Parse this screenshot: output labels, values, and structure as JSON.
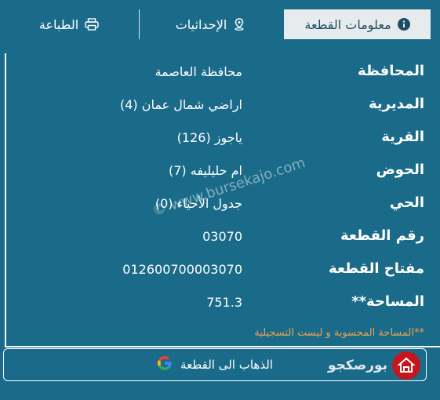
{
  "tabs": {
    "info": {
      "label": "معلومات القطعة",
      "icon": "info-icon"
    },
    "coords": {
      "label": "الإحداثيات",
      "icon": "location-pin-icon"
    },
    "print": {
      "label": "الطباعة",
      "icon": "printer-icon"
    }
  },
  "rows": [
    {
      "label": "المحافظة",
      "value": "محافظة العاصمة"
    },
    {
      "label": "المديرية",
      "value": "اراضي شمال عمان (4)"
    },
    {
      "label": "القرية",
      "value": "ياجوز (126)"
    },
    {
      "label": "الحوض",
      "value": "ام حليليفه (7)"
    },
    {
      "label": "الحي",
      "value": "جدول الأحياء (0)"
    },
    {
      "label": "رقم القطعة",
      "value": "03070"
    },
    {
      "label": "مفتاح القطعة",
      "value": "012600700003070"
    },
    {
      "label": "المساحة**",
      "value": "751.3"
    }
  ],
  "note": "**المساحة المحسوبة و ليست التسجيلية",
  "goto_button": {
    "label": "الذهاب الى القطعة",
    "icon": "google-icon"
  },
  "brand": {
    "text": "بورصكجو"
  },
  "watermark": "© www.bursekajo.com",
  "colors": {
    "background": "#1a6b8a",
    "active_tab": "#e6ebee",
    "note": "#f0a050",
    "logo": "#c4161c"
  }
}
